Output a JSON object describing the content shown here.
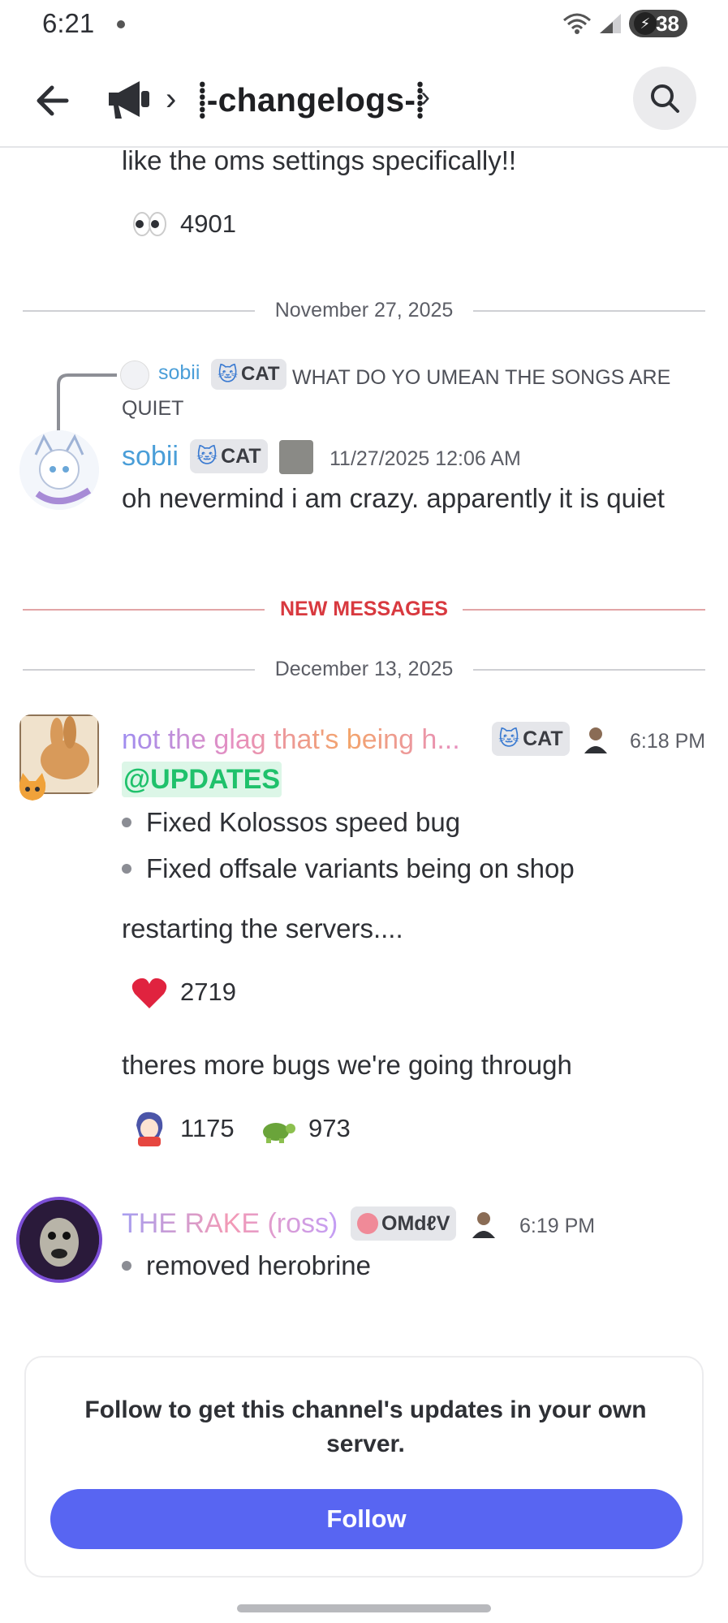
{
  "status_bar": {
    "time": "6:21",
    "battery": "38",
    "wifi_badge": "5"
  },
  "header": {
    "channel_name": "⸽-changelogs-⸽",
    "back_icon": "arrow-left-icon",
    "channel_icon": "megaphone-icon",
    "search_icon": "search-icon"
  },
  "messages": {
    "prev_tail": {
      "text": "like the oms settings specifically!!",
      "reaction_emoji": "eyes",
      "reaction_count": "4901"
    },
    "date_1": "November 27, 2025",
    "sobii": {
      "reply": {
        "author": "sobii",
        "tag": "CAT",
        "text": "WHAT DO YO UMEAN THE SONGS ARE QUIET"
      },
      "author": "sobii",
      "tag": "CAT",
      "timestamp": "11/27/2025 12:06 AM",
      "text": "oh nevermind i am crazy. apparently it is quiet"
    },
    "new_messages": "NEW MESSAGES",
    "date_2": "December 13, 2025",
    "glag": {
      "author": "not the glag that's being h...",
      "tag": "CAT",
      "timestamp": "6:18 PM",
      "mention": "@UPDATES",
      "bullets": [
        "Fixed Kolossos speed bug",
        "Fixed offsale variants being on shop"
      ],
      "text_1": "restarting the servers....",
      "reaction_1": {
        "emoji": "heart",
        "count": "2719"
      },
      "text_2": "theres more bugs we're going through",
      "reaction_2": {
        "emoji": "anime-girl",
        "count": "1175"
      },
      "reaction_3": {
        "emoji": "turtle",
        "count": "973"
      }
    },
    "rake": {
      "author": "THE RAKE (ross)",
      "tag": "OMdℓV",
      "timestamp": "6:19 PM",
      "bullets": [
        "removed herobrine"
      ]
    }
  },
  "follow_card": {
    "text": "Follow to get this channel's updates in your own server.",
    "button": "Follow"
  },
  "colors": {
    "accent": "#5865f2",
    "new_messages": "#d8393f",
    "mention": "#1fc16b",
    "sobii_name": "#4a9ed8"
  }
}
